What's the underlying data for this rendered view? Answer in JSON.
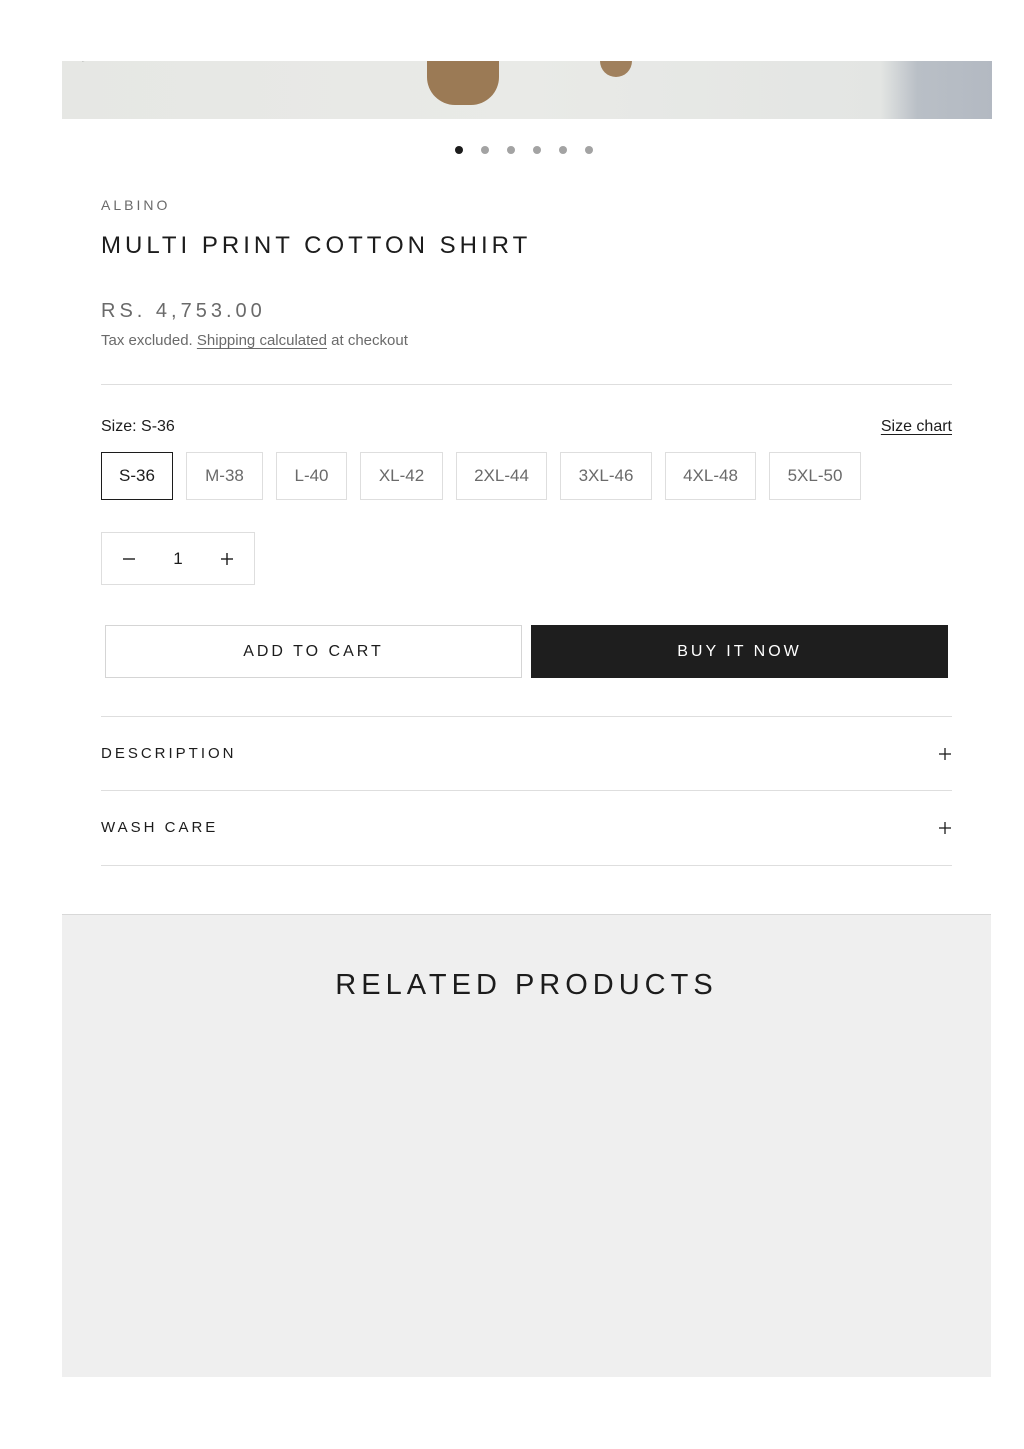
{
  "gallery": {
    "slide_count": 6,
    "active_slide": 1
  },
  "product": {
    "vendor": "ALBINO",
    "title": "MULTI PRINT COTTON SHIRT",
    "price": "RS. 4,753.00",
    "tax_note_prefix": "Tax excluded. ",
    "shipping_link": "Shipping calculated",
    "tax_note_suffix": " at checkout"
  },
  "size": {
    "label": "Size: S-36",
    "chart_link": "Size chart",
    "options": [
      "S-36",
      "M-38",
      "L-40",
      "XL-42",
      "2XL-44",
      "3XL-46",
      "4XL-48",
      "5XL-50"
    ],
    "selected": "S-36"
  },
  "quantity": {
    "value": "1",
    "minus_icon": "minus-icon",
    "plus_icon": "plus-icon"
  },
  "buttons": {
    "add_to_cart": "ADD TO CART",
    "buy_now": "BUY IT NOW"
  },
  "accordion": [
    {
      "title": "DESCRIPTION"
    },
    {
      "title": "WASH CARE"
    }
  ],
  "related": {
    "title": "RELATED PRODUCTS"
  },
  "colors": {
    "text": "#1c1c1c",
    "muted": "#6a6a6a",
    "border": "#dedede",
    "buy_button": "#1e1e1e",
    "related_bg": "#efefef"
  }
}
